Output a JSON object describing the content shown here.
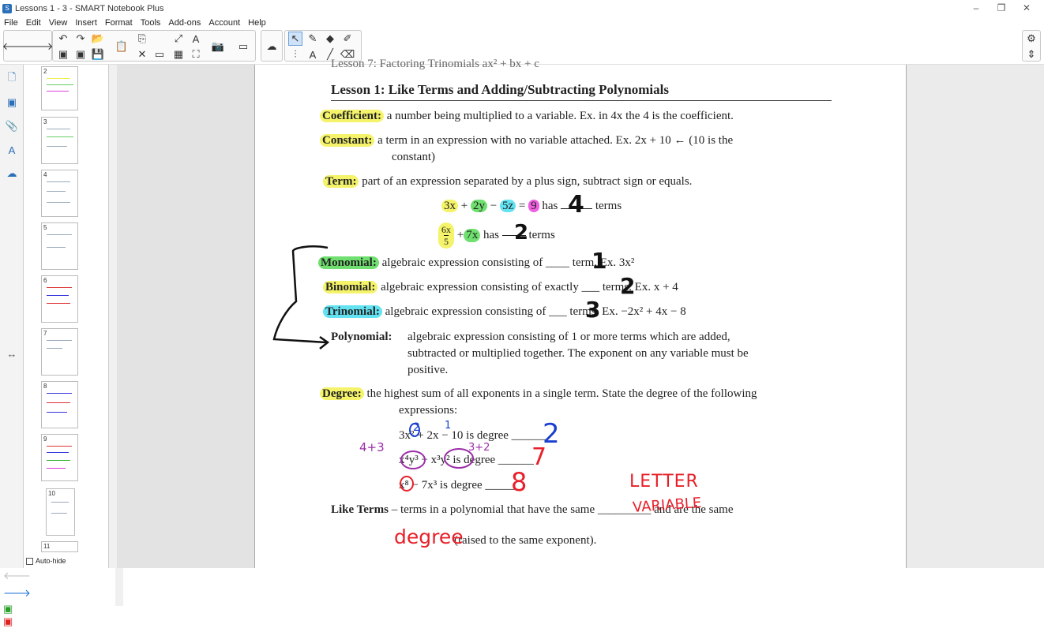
{
  "window": {
    "title": "Lessons 1 - 3 - SMART Notebook Plus",
    "controls": [
      "–",
      "❐",
      "✕"
    ]
  },
  "menu": [
    "File",
    "Edit",
    "View",
    "Insert",
    "Format",
    "Tools",
    "Add-ons",
    "Account",
    "Help"
  ],
  "sidebar": {
    "pages": [
      "2",
      "3",
      "4",
      "5",
      "6",
      "7",
      "8",
      "9",
      "10",
      "11"
    ],
    "autohide_label": "Auto-hide"
  },
  "doc": {
    "prev_title": "Lesson 7: Factoring Trinomials ax² + bx + c",
    "title": "Lesson 1: Like Terms and Adding/Subtracting Polynomials",
    "coef_label": "Coefficient:",
    "coef_text": "a number being multiplied to a variable. Ex. in 4x the 4 is the coefficient.",
    "const_label": "Constant:",
    "const_text1": "a term in an expression with no variable attached. Ex. 2x + 10 ← (10 is the",
    "const_text2": "constant)",
    "term_label": "Term:",
    "term_text": "part of an expression separated by a plus sign, subtract sign or equals.",
    "ex1_t1": "3x",
    "ex1_t2": "2y",
    "ex1_t3": "5z",
    "ex1_t4": "9",
    "ex1_has": "has",
    "ex1_terms": "terms",
    "ex2_frac_num": "6x",
    "ex2_frac_den": "5",
    "ex2_t2": "7x",
    "ex2_has": "has",
    "ex2_terms": "terms",
    "mono_label": "Monomial:",
    "mono_text": "algebraic expression consisting of ____ term. Ex. 3x²",
    "bino_label": "Binomial:",
    "bino_text": "algebraic expression consisting of exactly ___ terms. Ex. x + 4",
    "trino_label": "Trinomial:",
    "trino_text": "algebraic expression consisting of ___ terms. Ex. −2x² + 4x − 8",
    "poly_label": "Polynomial:",
    "poly_text1": "algebraic expression consisting of 1 or more terms which are added,",
    "poly_text2": "subtracted or multiplied together. The exponent on any variable must be",
    "poly_text3": "positive.",
    "deg_label": "Degree:",
    "deg_text1": "the highest sum of all exponents in a single term. State the degree of the following",
    "deg_text2": "expressions:",
    "deg_ex1": "3x² + 2x − 10 is degree ______",
    "deg_ex2": "x⁴y³ − x³y² is degree ______",
    "deg_ex3": "x⁸ − 7x³ is degree ______",
    "like_label": "Like Terms",
    "like_text1": "– terms in a polynomial that have the same _________ and are the same",
    "like_text2": "(raised to the same exponent)."
  },
  "ink": {
    "four": "4",
    "two": "2",
    "one": "1",
    "two_b": "2",
    "three": "3",
    "deg_a": "2",
    "deg_b": "7",
    "deg_c": "8",
    "side_note": "4+3",
    "sup_note": "3+2",
    "small_2": "2",
    "small_1": "1",
    "letter": "LETTER",
    "variable": "VARIABLE",
    "degree": "degree"
  },
  "colors": {
    "blue": "#1a3fd0",
    "red": "#e8202a",
    "purple": "#9b2fa8",
    "black": "#111"
  }
}
